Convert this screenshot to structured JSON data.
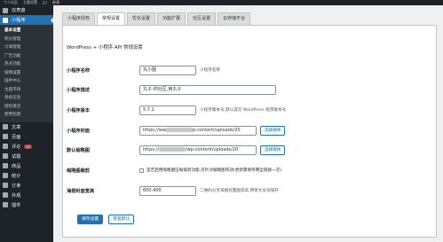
{
  "adminbar": {
    "items": [
      "个人社区",
      "主题设置",
      "27",
      "新建"
    ]
  },
  "sidebar": {
    "top_items": [
      {
        "label": "仪表盘",
        "icon": "dashboard-icon"
      }
    ],
    "active": {
      "label": "小程序",
      "icon": "miniprogram-icon"
    },
    "submenu": [
      "基本设置",
      "积分管理",
      "订阅管理",
      "广告功能",
      "热点功能",
      "投稿设置",
      "插件中心",
      "主题市场",
      "系统信息",
      "授权激活",
      "使用指南"
    ],
    "items": [
      {
        "label": "文章",
        "icon": "pin-icon"
      },
      {
        "label": "页面",
        "icon": "page-icon"
      },
      {
        "label": "评论",
        "icon": "comment-icon",
        "badge": "27"
      },
      {
        "label": "试题",
        "icon": "question-icon"
      },
      {
        "label": "商品",
        "icon": "shop-icon"
      },
      {
        "label": "统计",
        "icon": "chart-icon"
      },
      {
        "label": "订单",
        "icon": "order-icon"
      },
      {
        "label": "外观",
        "icon": "appearance-icon"
      },
      {
        "label": "插件",
        "icon": "plugin-icon"
      }
    ]
  },
  "tabs": [
    "小程序授权",
    "常规设置",
    "优化设置",
    "功能扩展",
    "社区设置",
    "云存储平台"
  ],
  "panel": {
    "title": "WordPress + 小程序 API 常规设置",
    "fields": [
      {
        "label": "小程序名称",
        "value": "丸小圈",
        "desc": "小程序名称"
      },
      {
        "label": "小程序描述",
        "value": "丸子-你社区,用丸子"
      },
      {
        "label": "小程序版本",
        "value": "5.7.2",
        "desc": "小程序版本号,默认提交 WordPress 程序版本号"
      },
      {
        "label": "小程序封面",
        "value_prefix": "https://ww",
        "value_suffix": "p-content/uploads/20",
        "button": "选择媒体"
      },
      {
        "label": "默认缩略图",
        "value_prefix": "https://",
        "value_suffix": "/wp-content/uploads/20",
        "button": "选择媒体"
      },
      {
        "label": "缩略图裁剪",
        "checkbox_text": "是否启用缩略图压缩裁剪功能,仅针对缩略图有效(更新需保存两全链接一次)"
      },
      {
        "label": "海报封面宽高",
        "value": "600,400",
        "desc": "二维码分享海报封面图宽高,用英文逗号隔开"
      }
    ],
    "save_label": "保存设置",
    "reset_label": "恢复默认"
  },
  "colors": {
    "accent": "#2271b1",
    "sidebar": "#1d2327",
    "badge": "#d63638"
  }
}
